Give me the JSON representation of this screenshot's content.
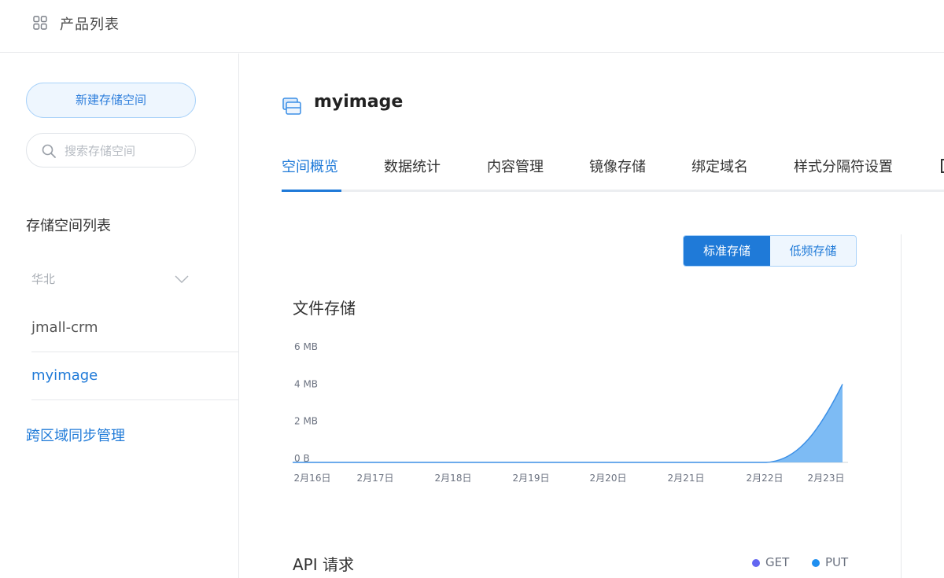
{
  "header": {
    "title": "产品列表",
    "icon": "grid-icon"
  },
  "sidebar": {
    "new_bucket_label": "新建存储空间",
    "search_placeholder": "搜索存储空间",
    "list_heading": "存储空间列表",
    "region": "华北",
    "buckets": [
      {
        "name": "jmall-crm",
        "selected": false
      },
      {
        "name": "myimage",
        "selected": true
      }
    ],
    "cross_region_link": "跨区域同步管理"
  },
  "main": {
    "bucket_name": "myimage",
    "tabs": [
      {
        "label": "空间概览",
        "active": true
      },
      {
        "label": "数据统计",
        "active": false
      },
      {
        "label": "内容管理",
        "active": false
      },
      {
        "label": "镜像存储",
        "active": false
      },
      {
        "label": "绑定域名",
        "active": false
      },
      {
        "label": "样式分隔符设置",
        "active": false
      }
    ],
    "storage_toggle": {
      "standard": "标准存储",
      "infrequent": "低频存储",
      "selected": "标准存储"
    },
    "file_storage_title": "文件存储",
    "api_title": "API 请求",
    "legend": [
      {
        "name": "GET",
        "color": "#6366f1"
      },
      {
        "name": "PUT",
        "color": "#1f8ff0"
      }
    ]
  },
  "colors": {
    "accent": "#1f7ad8",
    "area_fill": "#6fb4f3",
    "area_stroke": "#3b8fe6"
  },
  "chart_data": {
    "type": "area",
    "x": [
      "2月16日",
      "2月17日",
      "2月18日",
      "2月19日",
      "2月20日",
      "2月21日",
      "2月22日",
      "2月23日"
    ],
    "series": [
      {
        "values": [
          0,
          0,
          0,
          0,
          0,
          0,
          0,
          4.2
        ]
      }
    ],
    "y_ticks": [
      "0 B",
      "2 MB",
      "4 MB",
      "6 MB"
    ],
    "ylim": [
      0,
      6
    ],
    "grid": false
  }
}
